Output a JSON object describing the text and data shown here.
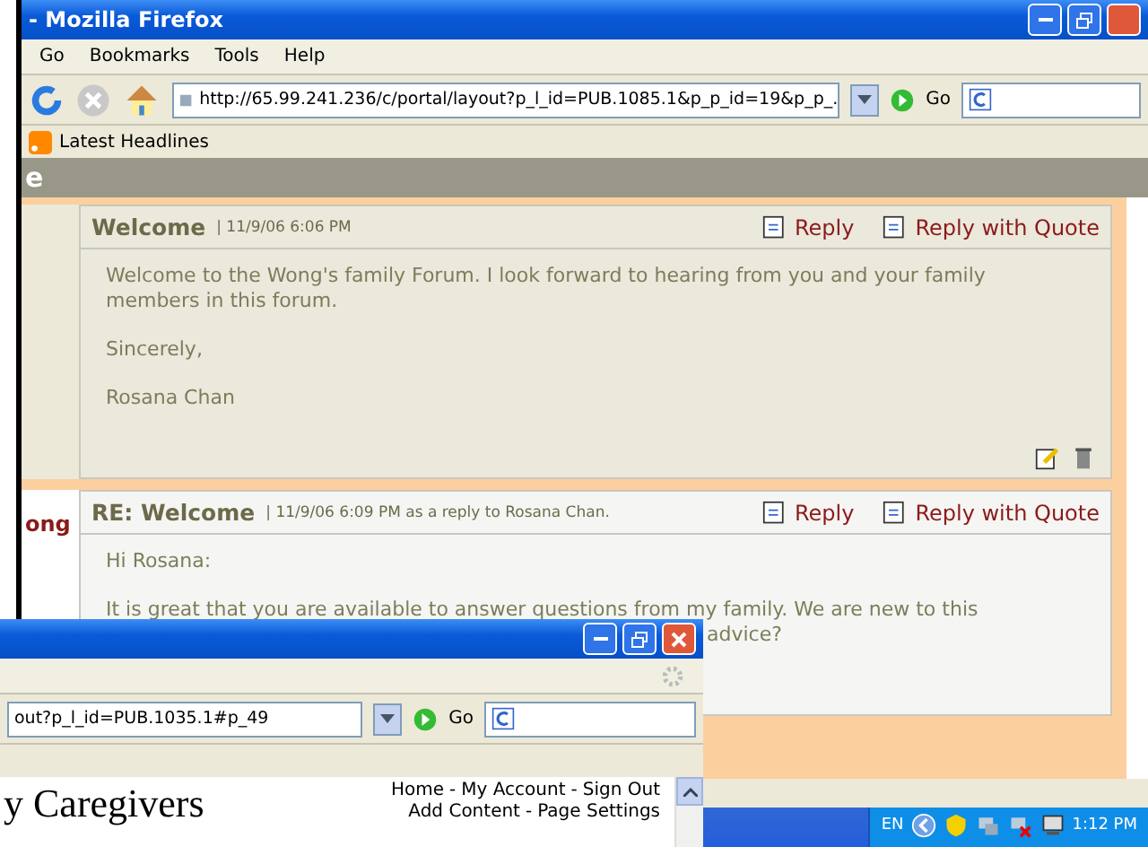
{
  "main_window": {
    "title": "- Mozilla Firefox",
    "menu": [
      "Go",
      "Bookmarks",
      "Tools",
      "Help"
    ],
    "address": "http://65.99.241.236/c/portal/layout?p_l_id=PUB.1085.1&p_p_id=19&p_p_.",
    "go": "Go",
    "bookmarks": [
      "Latest Headlines"
    ],
    "page_header": "e",
    "posts": [
      {
        "title": "Welcome",
        "meta": "| 11/9/06 6:06 PM",
        "actions": [
          "Reply",
          "Reply with Quote"
        ],
        "lines": [
          {
            "text": "Welcome to the Wong's family Forum. I look forward to hearing from you and your family members in this forum.",
            "kind": "para"
          },
          {
            "text": "Sincerely,",
            "kind": "para"
          },
          {
            "text": "Rosana Chan",
            "kind": "para"
          }
        ],
        "tools": true
      },
      {
        "author": "ong",
        "title": "RE: Welcome",
        "meta": "| 11/9/06 6:09 PM as a reply to Rosana Chan.",
        "actions": [
          "Reply",
          "Reply with Quote"
        ],
        "lines": [
          {
            "text": "Hi Rosana:",
            "kind": "para"
          },
          {
            "text": "It is great that you are available to answer questions from my family. We are new to this",
            "kind": "line"
          },
          {
            "text": "advice?",
            "kind": "tail"
          }
        ],
        "tools": false
      }
    ]
  },
  "second_window": {
    "address": "out?p_l_id=PUB.1035.1#p_49",
    "go": "Go",
    "site_title": "y Caregivers",
    "separator": "-",
    "links": [
      [
        "Home",
        "My Account",
        "Sign Out"
      ],
      [
        "Add Content",
        "Page Settings"
      ]
    ]
  },
  "taskbar": {
    "language": "EN",
    "clock": "1:12 PM"
  }
}
